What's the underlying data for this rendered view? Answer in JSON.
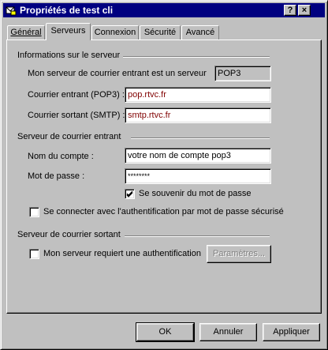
{
  "window": {
    "title": "Propriétés de test cli",
    "help_btn": "?",
    "close_btn": "×"
  },
  "tabs": [
    "Général",
    "Serveurs",
    "Connexion",
    "Sécurité",
    "Avancé"
  ],
  "active_tab": "Serveurs",
  "server_info": {
    "group_label": "Informations sur le serveur",
    "incoming_type_label": "Mon serveur de courrier entrant est un serveur",
    "incoming_type_value": "POP3",
    "incoming_label": "Courrier entrant (POP3) :",
    "incoming_value": "pop.rtvc.fr",
    "outgoing_label": "Courrier sortant (SMTP) :",
    "outgoing_value": "smtp.rtvc.fr"
  },
  "incoming_server": {
    "group_label": "Serveur de courrier entrant",
    "account_label": "Nom du compte :",
    "account_value": "votre nom de compte pop3",
    "password_label": "Mot de passe :",
    "password_value": "********",
    "remember_label": "Se souvenir du mot de passe",
    "remember_checked": true,
    "spa_label": "Se connecter avec l'authentification par mot de passe sécurisé",
    "spa_checked": false
  },
  "outgoing_server": {
    "group_label": "Serveur de courrier sortant",
    "auth_label": "Mon serveur requiert une authentification",
    "auth_checked": false,
    "settings_button": "Paramètres..."
  },
  "footer": {
    "ok": "OK",
    "cancel": "Annuler",
    "apply": "Appliquer"
  },
  "colors": {
    "title_bar": "#000080",
    "field_text": "#800000",
    "face": "#c0c0c0"
  }
}
